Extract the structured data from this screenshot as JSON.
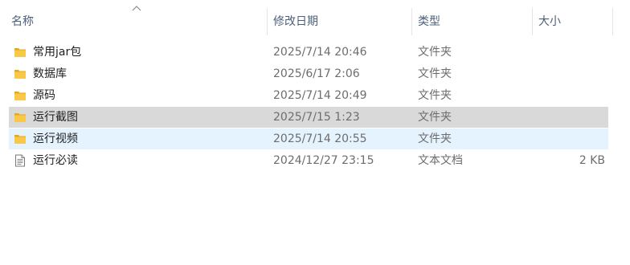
{
  "columns": {
    "name": "名称",
    "modified": "修改日期",
    "type": "类型",
    "size": "大小"
  },
  "sort": {
    "column": "name",
    "direction": "ascending",
    "icon": "chevron-up-icon"
  },
  "files": [
    {
      "name": "常用jar包",
      "modified": "2025/7/14 20:46",
      "type": "文件夹",
      "size": "",
      "icon": "folder-icon",
      "state": "normal"
    },
    {
      "name": "数据库",
      "modified": "2025/6/17 2:06",
      "type": "文件夹",
      "size": "",
      "icon": "folder-icon",
      "state": "normal"
    },
    {
      "name": "源码",
      "modified": "2025/7/14 20:49",
      "type": "文件夹",
      "size": "",
      "icon": "folder-icon",
      "state": "normal"
    },
    {
      "name": "运行截图",
      "modified": "2025/7/15 1:23",
      "type": "文件夹",
      "size": "",
      "icon": "folder-icon",
      "state": "selected"
    },
    {
      "name": "运行视频",
      "modified": "2025/7/14 20:55",
      "type": "文件夹",
      "size": "",
      "icon": "folder-icon",
      "state": "hover"
    },
    {
      "name": "运行必读",
      "modified": "2024/12/27 23:15",
      "type": "文本文档",
      "size": "2 KB",
      "icon": "text-document-icon",
      "state": "normal"
    }
  ],
  "colors": {
    "header_text": "#4c607a",
    "selected_row": "#d9d9d9",
    "hover_row": "#e5f3ff",
    "folder": "#f8c846",
    "folder_dark": "#e3a822"
  }
}
